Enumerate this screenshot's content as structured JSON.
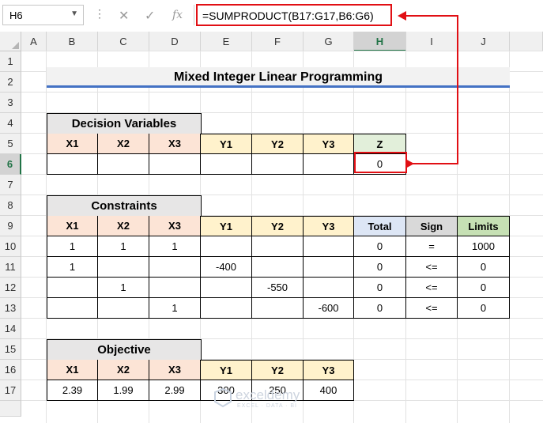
{
  "formula_bar": {
    "name_box": "H6",
    "formula": "=SUMPRODUCT(B17:G17,B6:G6)",
    "fx_label": "fx"
  },
  "columns": [
    "A",
    "B",
    "C",
    "D",
    "E",
    "F",
    "G",
    "H",
    "I",
    "J"
  ],
  "rows": [
    "1",
    "2",
    "3",
    "4",
    "5",
    "6",
    "7",
    "8",
    "9",
    "10",
    "11",
    "12",
    "13",
    "14",
    "15",
    "16",
    "17"
  ],
  "title": "Mixed Integer Linear Programming",
  "decision_variables": {
    "heading": "Decision Variables",
    "headers": [
      "X1",
      "X2",
      "X3",
      "Y1",
      "Y2",
      "Y3",
      "Z"
    ],
    "values": [
      "",
      "",
      "",
      "",
      "",
      "",
      "0"
    ]
  },
  "constraints": {
    "heading": "Constraints",
    "headers": [
      "X1",
      "X2",
      "X3",
      "Y1",
      "Y2",
      "Y3",
      "Total",
      "Sign",
      "Limits"
    ],
    "rows": [
      [
        "1",
        "1",
        "1",
        "",
        "",
        "",
        "0",
        "=",
        "1000"
      ],
      [
        "1",
        "",
        "",
        "-400",
        "",
        "",
        "0",
        "<=",
        "0"
      ],
      [
        "",
        "1",
        "",
        "",
        "-550",
        "",
        "0",
        "<=",
        "0"
      ],
      [
        "",
        "",
        "1",
        "",
        "",
        "-600",
        "0",
        "<=",
        "0"
      ]
    ]
  },
  "objective": {
    "heading": "Objective",
    "headers": [
      "X1",
      "X2",
      "X3",
      "Y1",
      "Y2",
      "Y3"
    ],
    "values": [
      "2.39",
      "1.99",
      "2.99",
      "300",
      "250",
      "400"
    ]
  },
  "watermark": {
    "name": "exceldemy",
    "tagline": "EXCEL · DATA · BI"
  },
  "colors": {
    "accent_red": "#e10f14",
    "excel_green": "#217346",
    "title_underline": "#4472c4"
  }
}
